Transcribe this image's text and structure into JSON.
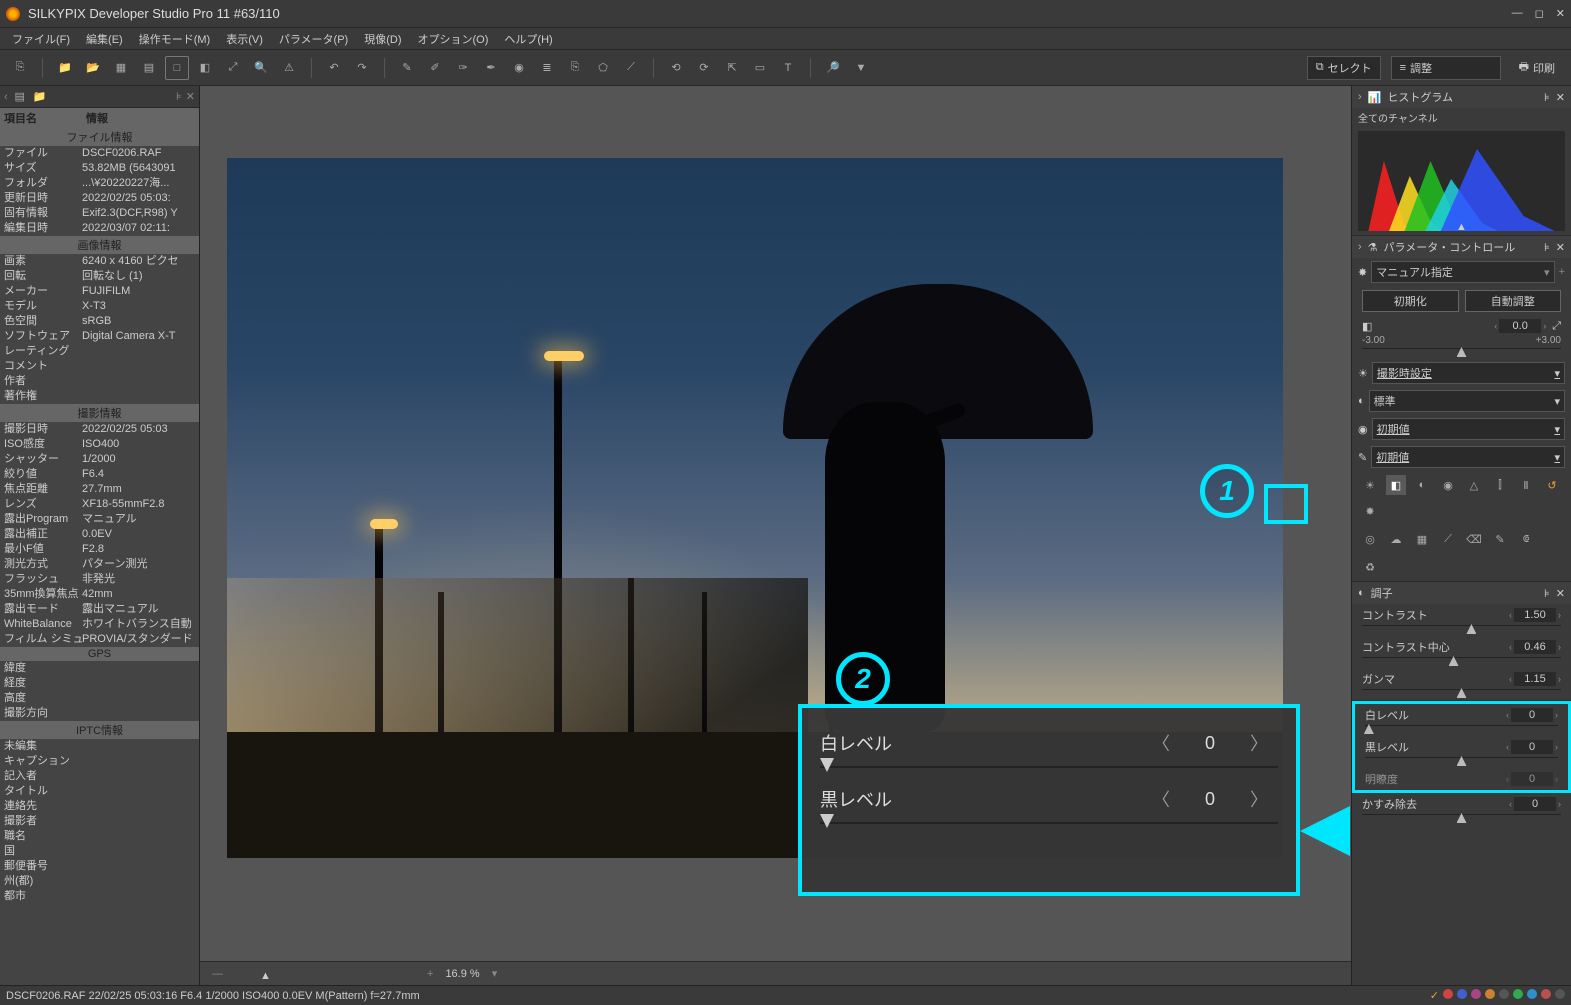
{
  "app": {
    "title": "SILKYPIX Developer Studio Pro 11    #63/110"
  },
  "menus": [
    "ファイル(F)",
    "編集(E)",
    "操作モード(M)",
    "表示(V)",
    "パラメータ(P)",
    "現像(D)",
    "オプション(O)",
    "ヘルプ(H)"
  ],
  "toolbar_mode_select": "セレクト",
  "toolbar_mode_adjust": "調整",
  "toolbar_print": "印刷",
  "left": {
    "col1": "項目名",
    "col2": "情報",
    "sections": [
      {
        "name": "ファイル情報",
        "rows": [
          [
            "ファイル",
            "DSCF0206.RAF"
          ],
          [
            "サイズ",
            "53.82MB (5643091"
          ],
          [
            "フォルダ",
            "...\\¥20220227海..."
          ],
          [
            "更新日時",
            "2022/02/25 05:03:"
          ],
          [
            "固有情報",
            "Exif2.3(DCF,R98) Y"
          ],
          [
            "編集日時",
            "2022/03/07 02:11:"
          ]
        ]
      },
      {
        "name": "画像情報",
        "rows": [
          [
            "画素",
            "6240 x 4160 ピクセ"
          ],
          [
            "回転",
            "回転なし (1)"
          ],
          [
            "メーカー",
            "FUJIFILM"
          ],
          [
            "モデル",
            "X-T3"
          ],
          [
            "色空間",
            "sRGB"
          ],
          [
            "ソフトウェア",
            "Digital Camera X-T"
          ],
          [
            "レーティング",
            ""
          ],
          [
            "コメント",
            ""
          ],
          [
            "作者",
            ""
          ],
          [
            "著作権",
            ""
          ]
        ]
      },
      {
        "name": "撮影情報",
        "rows": [
          [
            "撮影日時",
            "2022/02/25 05:03"
          ],
          [
            "ISO感度",
            "ISO400"
          ],
          [
            "シャッター",
            "1/2000"
          ],
          [
            "絞り値",
            "F6.4"
          ],
          [
            "焦点距離",
            "27.7mm"
          ],
          [
            "レンズ",
            "XF18-55mmF2.8"
          ],
          [
            "露出Program",
            "マニュアル"
          ],
          [
            "露出補正",
            "0.0EV"
          ],
          [
            "最小F値",
            "F2.8"
          ],
          [
            "測光方式",
            "パターン測光"
          ],
          [
            "フラッシュ",
            "非発光"
          ],
          [
            "35mm換算焦点",
            "42mm"
          ],
          [
            "露出モード",
            "露出マニュアル"
          ],
          [
            "WhiteBalance",
            "ホワイトバランス自動"
          ],
          [
            "フィルム シミュレー",
            "PROVIA/スタンダード"
          ]
        ]
      },
      {
        "name": "GPS",
        "rows": [
          [
            "緯度",
            ""
          ],
          [
            "経度",
            ""
          ],
          [
            "高度",
            ""
          ],
          [
            "撮影方向",
            ""
          ]
        ]
      },
      {
        "name": "IPTC情報",
        "rows": [
          [
            "未編集",
            ""
          ],
          [
            "キャプション",
            ""
          ],
          [
            "記入者",
            ""
          ],
          [
            "タイトル",
            ""
          ],
          [
            "連絡先",
            ""
          ],
          [
            "撮影者",
            ""
          ],
          [
            "職名",
            ""
          ],
          [
            "国",
            ""
          ],
          [
            "郵便番号",
            ""
          ],
          [
            "州(都)",
            ""
          ],
          [
            "都市",
            ""
          ]
        ]
      }
    ]
  },
  "zoom_pct": "16.9 %",
  "right": {
    "histogram_title": "ヒストグラム",
    "channel_label": "全てのチャンネル",
    "param_control_title": "パラメータ・コントロール",
    "mode_dd": "マニュアル指定",
    "btn_init": "初期化",
    "btn_auto": "自動調整",
    "exposure_val": "0.0",
    "exposure_min": "-3.00",
    "exposure_max": "+3.00",
    "dd_shoot": "撮影時設定",
    "dd_std": "標準",
    "dd_def1": "初期値",
    "dd_def2": "初期値",
    "tone_title": "調子",
    "contrast_label": "コントラスト",
    "contrast_val": "1.50",
    "contrast_center_label": "コントラスト中心",
    "contrast_center_val": "0.46",
    "gamma_label": "ガンマ",
    "gamma_val": "1.15",
    "white_label": "白レベル",
    "white_val": "0",
    "black_label": "黒レベル",
    "black_val": "0",
    "clarity_label": "明瞭度",
    "clarity_val": "0",
    "dehaze_label": "かすみ除去",
    "dehaze_val": "0"
  },
  "inset": {
    "white_label": "白レベル",
    "white_val": "0",
    "black_label": "黒レベル",
    "black_val": "0"
  },
  "status": "DSCF0206.RAF 22/02/25 05:03:16 F6.4 1/2000 ISO400  0.0EV M(Pattern) f=27.7mm",
  "chart_data": {
    "type": "area",
    "note": "luminance/RGB histogram — approximate channel distributions (0-255 bins, relative height 0-100)",
    "xlim": [
      0,
      255
    ],
    "ylim": [
      0,
      100
    ],
    "series": [
      {
        "name": "R",
        "color": "#ff2020",
        "x_peak": 40,
        "y_peak": 85,
        "spread": 30
      },
      {
        "name": "Y",
        "color": "#ffe020",
        "x_peak": 70,
        "y_peak": 70,
        "spread": 35
      },
      {
        "name": "G",
        "color": "#20c020",
        "x_peak": 95,
        "y_peak": 78,
        "spread": 40
      },
      {
        "name": "C",
        "color": "#20c0e0",
        "x_peak": 120,
        "y_peak": 60,
        "spread": 45
      },
      {
        "name": "B",
        "color": "#3050ff",
        "x_peak": 150,
        "y_peak": 90,
        "spread": 55
      }
    ]
  }
}
